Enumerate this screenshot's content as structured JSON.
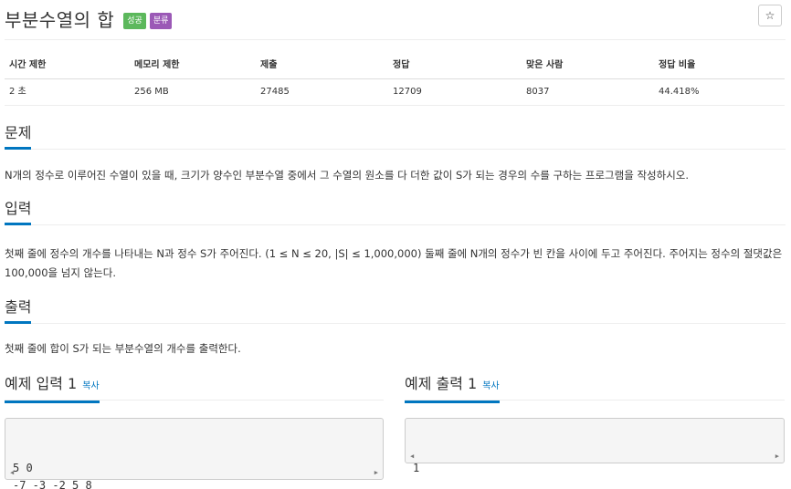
{
  "problem": {
    "title": "부분수열의 합",
    "badges": {
      "success": "성공",
      "category": "분류"
    },
    "star_icon": "☆"
  },
  "stats": {
    "headers": [
      "시간 제한",
      "메모리 제한",
      "제출",
      "정답",
      "맞은 사람",
      "정답 비율"
    ],
    "values": [
      "2 초",
      "256 MB",
      "27485",
      "12709",
      "8037",
      "44.418%"
    ]
  },
  "sections": {
    "description": {
      "title": "문제",
      "text": "N개의 정수로 이루어진 수열이 있을 때, 크기가 양수인 부분수열 중에서 그 수열의 원소를 다 더한 값이 S가 되는 경우의 수를 구하는 프로그램을 작성하시오."
    },
    "input": {
      "title": "입력",
      "text": "첫째 줄에 정수의 개수를 나타내는 N과 정수 S가 주어진다. (1 ≤ N ≤ 20, |S| ≤ 1,000,000) 둘째 줄에 N개의 정수가 빈 칸을 사이에 두고 주어진다. 주어지는 정수의 절댓값은 100,000을 넘지 않는다."
    },
    "output": {
      "title": "출력",
      "text": "첫째 줄에 합이 S가 되는 부분수열의 개수를 출력한다."
    }
  },
  "samples": {
    "input": {
      "title": "예제 입력 1",
      "copy_label": "복사",
      "content": "5 0\n-7 -3 -2 5 8"
    },
    "output": {
      "title": "예제 출력 1",
      "copy_label": "복사",
      "content": "1"
    }
  },
  "scroll_arrows": {
    "left": "◀",
    "right": "▶"
  }
}
